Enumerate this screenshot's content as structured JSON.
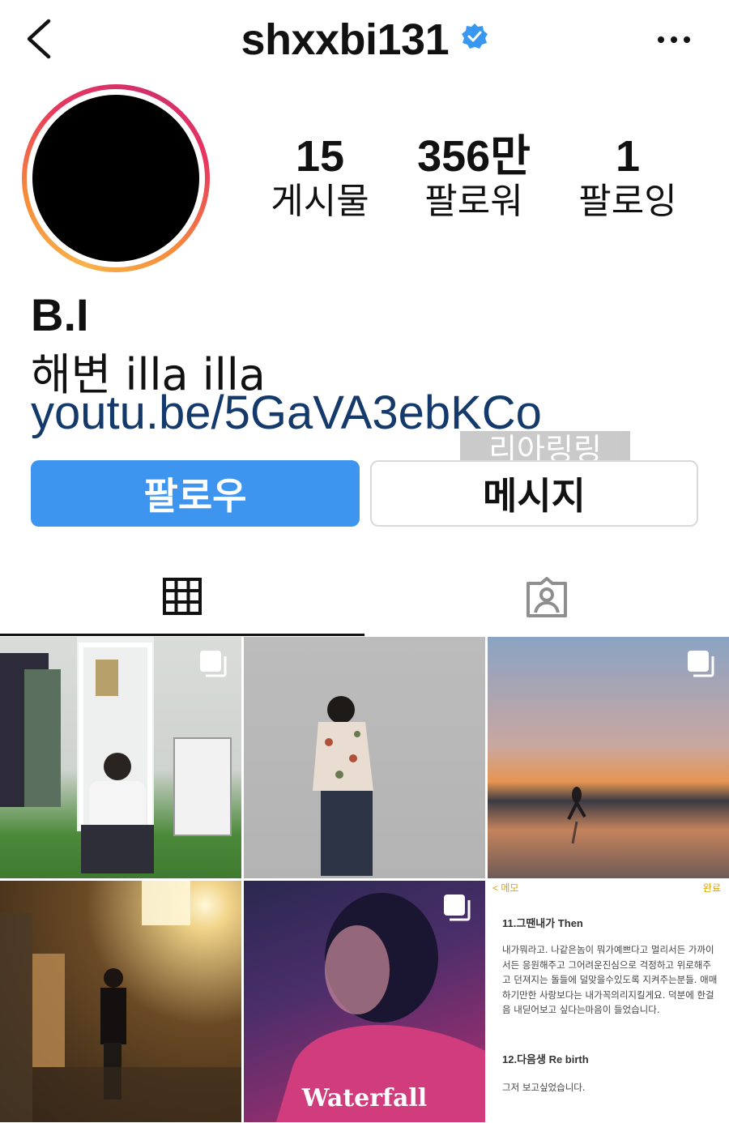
{
  "header": {
    "username": "shxxbi131",
    "back_icon": "chevron-left-icon",
    "verified_icon": "verified-badge-icon",
    "more_icon": "more-horizontal-icon"
  },
  "profile": {
    "stats": [
      {
        "value": "15",
        "label": "게시물"
      },
      {
        "value": "356만",
        "label": "팔로워"
      },
      {
        "value": "1",
        "label": "팔로잉"
      }
    ],
    "name": "B.I",
    "bio": "해변 illa illa",
    "link": "youtu.be/5GaVA3ebKCo",
    "watermark": "리아링링blog"
  },
  "actions": {
    "follow_label": "팔로우",
    "message_label": "메시지"
  },
  "tabs": [
    {
      "icon": "grid-icon",
      "active": true
    },
    {
      "icon": "tagged-person-icon",
      "active": false
    }
  ],
  "posts": {
    "memo": {
      "top_left": "< 메모",
      "top_right": "완료",
      "title": "11.그땐내가 Then",
      "body": "내가뭐라고. 나같은놈이 뭐가예쁘다고 멀리서든 가까이서든 응원해주고 그어려운진심으로 걱정하고 위로해주고 던져지는 돌들에 덜맞을수있도록 지켜주는분들. 애매하기만한 사랑보다는 내가꼭의리지킬게요. 덕분에 한걸음 내딛어보고 싶다는마음이 들었습니다.",
      "title2": "12.다음생 Re birth",
      "body2": "그저 보고싶었습니다."
    },
    "album_text": "Waterfall"
  },
  "colors": {
    "follow_button": "#3d95ef",
    "link": "#14396b",
    "verified": "#3897f0"
  }
}
